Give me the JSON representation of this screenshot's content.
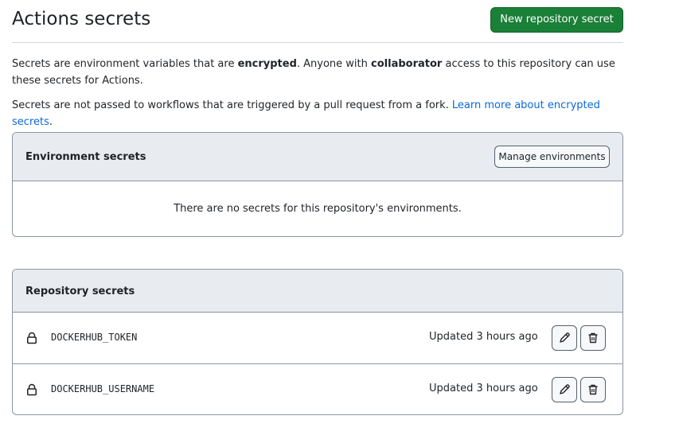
{
  "header": {
    "title": "Actions secrets",
    "new_secret_button": "New repository secret"
  },
  "description": {
    "p1_a": "Secrets are environment variables that are ",
    "p1_b": "encrypted",
    "p1_c": ". Anyone with ",
    "p1_d": "collaborator",
    "p1_e": " access to this repository can use these secrets for Actions.",
    "p2_text": "Secrets are not passed to workflows that are triggered by a pull request from a fork. ",
    "p2_link": "Learn more about encrypted secrets",
    "p2_end": "."
  },
  "environment_secrets": {
    "title": "Environment secrets",
    "manage_button": "Manage environments",
    "empty_message": "There are no secrets for this repository's environments."
  },
  "repository_secrets": {
    "title": "Repository secrets",
    "items": [
      {
        "name": "DOCKERHUB_TOKEN",
        "updated": "Updated 3 hours ago"
      },
      {
        "name": "DOCKERHUB_USERNAME",
        "updated": "Updated 3 hours ago"
      }
    ]
  },
  "icons": {
    "lock": "lock-icon",
    "edit": "pencil-icon",
    "delete": "trash-icon"
  },
  "colors": {
    "primary_button": "#1a7f37",
    "link": "#0969da",
    "box_header": "#e8ecf0"
  }
}
